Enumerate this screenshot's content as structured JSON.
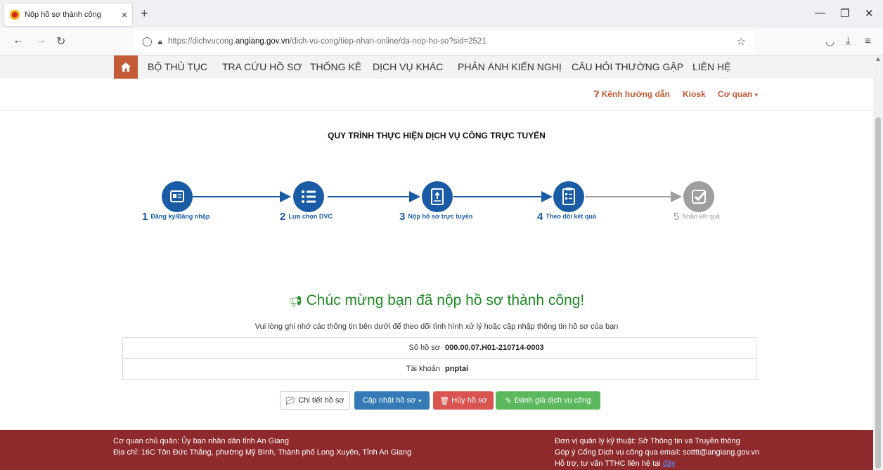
{
  "browser": {
    "tab_title": "Nộp hồ sơ thành công",
    "tab_close": "×",
    "new_tab": "+",
    "url_prefix": "https://dichvucong.",
    "url_domain": "angiang.gov.vn",
    "url_path": "/dich-vu-cong/tiep-nhan-online/da-nop-ho-so?sid=2521"
  },
  "menu": {
    "items": [
      "BỘ THỦ TỤC",
      "TRA CỨU HỒ SƠ",
      "THỐNG KÊ",
      "DỊCH VỤ KHÁC",
      "PHẢN ÁNH KIẾN NGHỊ",
      "CÂU HỎI THƯỜNG GẶP",
      "LIÊN HỆ"
    ]
  },
  "toplinks": {
    "guide": "Kênh hướng dẫn",
    "kiosk": "Kiosk",
    "agency": "Cơ quan"
  },
  "process": {
    "title": "QUY TRÌNH THỰC HIỆN DỊCH VỤ CÔNG TRỰC TUYẾN",
    "steps": [
      {
        "num": "1",
        "label": "Đăng ký/Đăng nhập",
        "icon": "id-card-icon"
      },
      {
        "num": "2",
        "label": "Lựa chọn DVC",
        "icon": "list-icon"
      },
      {
        "num": "3",
        "label": "Nộp hồ sơ trực tuyến",
        "icon": "upload-document-icon"
      },
      {
        "num": "4",
        "label": "Theo dõi kết quả",
        "icon": "checklist-icon"
      },
      {
        "num": "5",
        "label": "Nhận kết quả",
        "icon": "check-square-icon"
      }
    ],
    "active_color": "#1a5ba6",
    "inactive_color": "#9e9e9e"
  },
  "result": {
    "congrats": "Chúc mừng bạn đã nộp hồ sơ thành công!",
    "note": "Vui lòng ghi nhớ các thông tin bên dưới để theo dõi tình hình xử lý hoặc cập nhập thông tin hồ sơ của bạn",
    "rows": [
      {
        "label": "Số hồ sơ",
        "value": "000.00.07.H01-210714-0003"
      },
      {
        "label": "Tài khoản",
        "value": "pnptai"
      }
    ]
  },
  "buttons": {
    "detail": "Chi tiết hồ sơ",
    "update": "Cập nhật hồ sơ",
    "cancel": "Hủy hồ sơ",
    "rate": "Đánh giá dịch vụ công"
  },
  "footer": {
    "left_line1": "Cơ quan chủ quản: Ủy ban nhân dân tỉnh An Giang",
    "left_line2": "Địa chỉ: 16C Tôn Đức Thắng, phường Mỹ Bình, Thành phố Long Xuyên, Tỉnh An Giang",
    "right_line1": "Đơn vị quản lý kỹ thuật: Sở Thông tin và Truyền thông",
    "right_line2": "Góp ý Cổng Dịch vụ công qua email: sotttt@angiang.gov.vn",
    "right_line3": "Hỗ trợ, tư vấn TTHC liên hệ tại",
    "right_link": "đây"
  },
  "colors": {
    "brand": "#c35b36",
    "footer": "#8e2a2b",
    "primary": "#337ab7",
    "danger": "#d9534f",
    "success": "#5cb85c",
    "congrats": "#1f8a22"
  }
}
